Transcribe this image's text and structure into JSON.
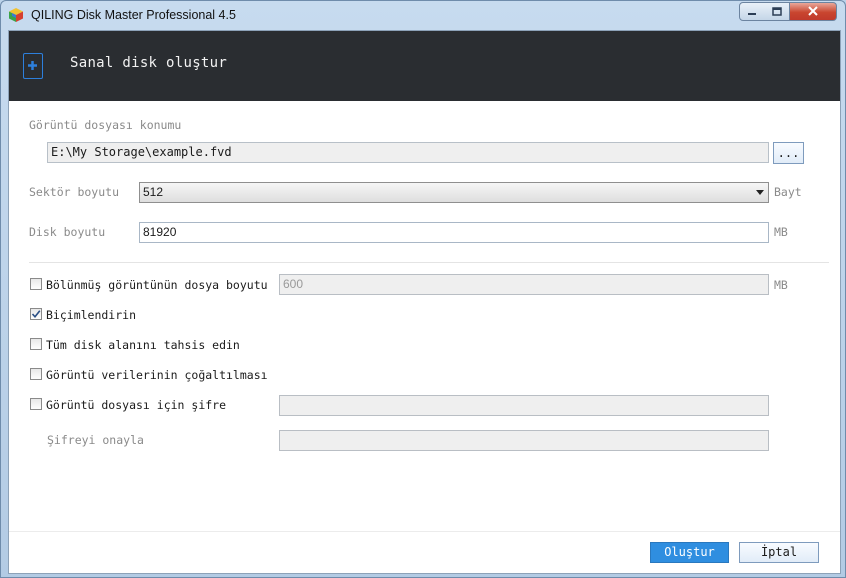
{
  "window": {
    "title": "QILING Disk Master Professional 4.5",
    "icons": {
      "app": "app-cube-icon",
      "minimize": "minimize-icon",
      "maximize": "maximize-icon",
      "close": "close-icon"
    }
  },
  "header": {
    "title": "Sanal disk oluştur",
    "icon": "virtual-disk-add-icon"
  },
  "image_location": {
    "label": "Görüntü dosyası konumu",
    "value": "E:\\My Storage\\example.fvd",
    "browse_label": "..."
  },
  "sector_size": {
    "label": "Sektör boyutu",
    "selected": "512",
    "unit": "Bayt"
  },
  "disk_size": {
    "label": "Disk boyutu",
    "value": "81920",
    "unit": "MB"
  },
  "options": {
    "split_image": {
      "label": "Bölünmüş görüntünün dosya boyutu",
      "checked": false,
      "value": "600",
      "unit": "MB"
    },
    "format": {
      "label": "Biçimlendirin",
      "checked": true
    },
    "allocate_all": {
      "label": "Tüm disk alanını tahsis edin",
      "checked": false
    },
    "replicate": {
      "label": "Görüntü verilerinin çoğaltılması",
      "checked": false
    },
    "password": {
      "label": "Görüntü dosyası için şifre",
      "checked": false,
      "value": ""
    },
    "confirm_password": {
      "label": "Şifreyi onayla",
      "value": ""
    }
  },
  "footer": {
    "create_label": "Oluştur",
    "cancel_label": "İptal"
  },
  "colors": {
    "header_bg": "#2a2d31",
    "accent": "#2f8ee0",
    "close_button": "#c9462f"
  }
}
